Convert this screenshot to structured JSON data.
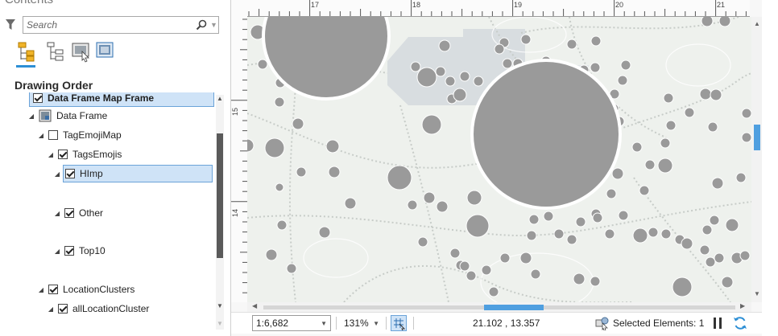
{
  "pane": {
    "title": "Contents",
    "search_placeholder": "Search",
    "section_title": "Drawing Order"
  },
  "icons": {
    "filter": "filter-icon",
    "search": "search-icon",
    "list_by_drawing_order": "drawing-order-icon",
    "list_by_source": "data-source-icon",
    "list_by_selection": "selection-icon",
    "list_by_snapping": "snapping-icon",
    "data_frame": "data-frame-icon"
  },
  "tree": {
    "map_frame": "Data Frame Map Frame",
    "data_frame": "Data Frame",
    "tag_emoji_map": "TagEmojiMap",
    "tags_emojis": "TagsEmojis",
    "himp": "HImp",
    "other": "Other",
    "top10": "Top10",
    "location_clusters": "LocationClusters",
    "all_location_cluster": "allLocationCluster"
  },
  "rulers": {
    "top": [
      "17",
      "18",
      "19",
      "20",
      "21"
    ],
    "left": [
      "15",
      "14"
    ]
  },
  "status": {
    "scale": "1:6,682",
    "zoom": "131%",
    "coordinates": "21.102 , 13.357",
    "selected": "Selected Elements: 1"
  },
  "colors": {
    "accent": "#2d8fd5",
    "selection_fill": "#cfe3f7",
    "symbol_gray": "#9a9a9a",
    "map_bg": "#eef1ed",
    "block_gray": "#d8dde0"
  }
}
